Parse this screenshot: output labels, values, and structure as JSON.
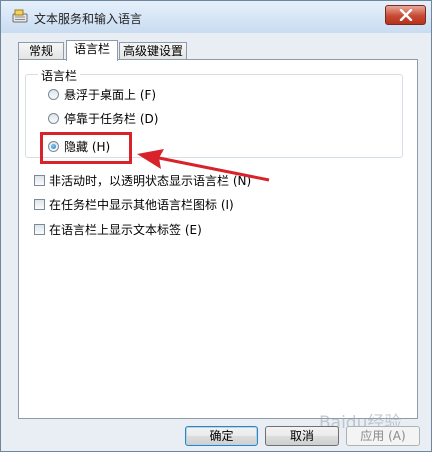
{
  "window": {
    "title": "文本服务和输入语言",
    "close_icon": "close-icon"
  },
  "tabs": [
    {
      "label": "常规",
      "active": false
    },
    {
      "label": "语言栏",
      "active": true
    },
    {
      "label": "高级键设置",
      "active": false
    }
  ],
  "language_bar": {
    "group_label": "语言栏",
    "radios": [
      {
        "label": "悬浮于桌面上 (F)",
        "checked": false
      },
      {
        "label": "停靠于任务栏 (D)",
        "checked": false
      },
      {
        "label": "隐藏 (H)",
        "checked": true
      }
    ],
    "checkboxes": [
      {
        "label": "非活动时，以透明状态显示语言栏 (N)",
        "checked": false
      },
      {
        "label": "在任务栏中显示其他语言栏图标 (I)",
        "checked": false
      },
      {
        "label": "在语言栏上显示文本标签 (E)",
        "checked": false
      }
    ]
  },
  "buttons": {
    "ok": "确定",
    "cancel": "取消",
    "apply": "应用 (A)"
  },
  "annotation": {
    "color": "#d9232b"
  },
  "watermark": "Baidu经验"
}
